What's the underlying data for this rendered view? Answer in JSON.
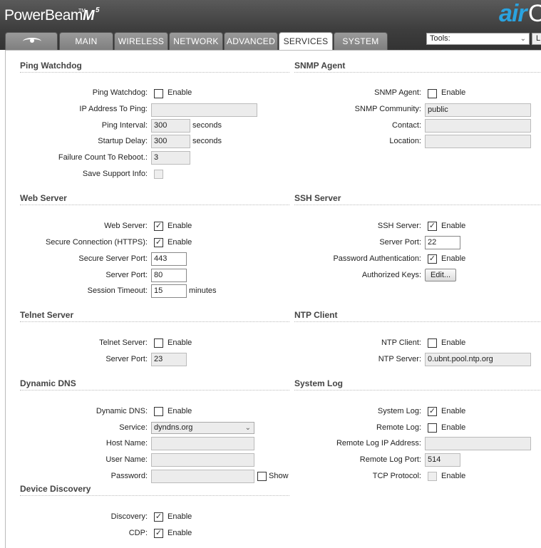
{
  "header": {
    "brand": "PowerBeam",
    "brand_tm": "TM",
    "brand_model": "M",
    "brand_model_sub": "5",
    "airos_air": "air",
    "airos_o": "O"
  },
  "tabs": [
    {
      "label": "",
      "icon": "ubiquiti-logo-icon"
    },
    {
      "label": "MAIN"
    },
    {
      "label": "WIRELESS"
    },
    {
      "label": "NETWORK"
    },
    {
      "label": "ADVANCED"
    },
    {
      "label": "SERVICES",
      "active": true
    },
    {
      "label": "SYSTEM"
    }
  ],
  "tools": {
    "selected": "Tools:",
    "button_label": "L"
  },
  "check_mark": "✓",
  "ping_watchdog": {
    "title": "Ping Watchdog",
    "enable_label": "Ping Watchdog:",
    "enable_text": "Enable",
    "enabled": false,
    "ip_label": "IP Address To Ping:",
    "ip_value": "",
    "interval_label": "Ping Interval:",
    "interval_value": "300",
    "interval_unit": "seconds",
    "startup_label": "Startup Delay:",
    "startup_value": "300",
    "startup_unit": "seconds",
    "failure_label": "Failure Count To Reboot.:",
    "failure_value": "3",
    "support_label": "Save Support Info:"
  },
  "snmp": {
    "title": "SNMP Agent",
    "agent_label": "SNMP Agent:",
    "enable_text": "Enable",
    "enabled": false,
    "community_label": "SNMP Community:",
    "community_value": "public",
    "contact_label": "Contact:",
    "contact_value": "",
    "location_label": "Location:",
    "location_value": ""
  },
  "web_server": {
    "title": "Web Server",
    "server_label": "Web Server:",
    "enable_text": "Enable",
    "enabled": true,
    "https_label": "Secure Connection (HTTPS):",
    "https_enabled": true,
    "secure_port_label": "Secure Server Port:",
    "secure_port_value": "443",
    "port_label": "Server Port:",
    "port_value": "80",
    "timeout_label": "Session Timeout:",
    "timeout_value": "15",
    "timeout_unit": "minutes"
  },
  "ssh": {
    "title": "SSH Server",
    "server_label": "SSH Server:",
    "enable_text": "Enable",
    "enabled": true,
    "port_label": "Server Port:",
    "port_value": "22",
    "password_label": "Password Authentication:",
    "password_enabled": true,
    "keys_label": "Authorized Keys:",
    "keys_button": "Edit..."
  },
  "telnet": {
    "title": "Telnet Server",
    "server_label": "Telnet Server:",
    "enable_text": "Enable",
    "enabled": false,
    "port_label": "Server Port:",
    "port_value": "23"
  },
  "ntp": {
    "title": "NTP Client",
    "client_label": "NTP Client:",
    "enable_text": "Enable",
    "enabled": false,
    "server_label": "NTP Server:",
    "server_value": "0.ubnt.pool.ntp.org"
  },
  "ddns": {
    "title": "Dynamic DNS",
    "ddns_label": "Dynamic DNS:",
    "enable_text": "Enable",
    "enabled": false,
    "service_label": "Service:",
    "service_value": "dyndns.org",
    "host_label": "Host Name:",
    "host_value": "",
    "user_label": "User Name:",
    "user_value": "",
    "password_label": "Password:",
    "password_value": "",
    "show_text": "Show"
  },
  "syslog": {
    "title": "System Log",
    "log_label": "System Log:",
    "enable_text": "Enable",
    "enabled": true,
    "remote_label": "Remote Log:",
    "remote_enabled": false,
    "remote_ip_label": "Remote Log IP Address:",
    "remote_ip_value": "",
    "remote_port_label": "Remote Log Port:",
    "remote_port_value": "514",
    "tcp_label": "TCP Protocol:"
  },
  "discovery": {
    "title": "Device Discovery",
    "discovery_label": "Discovery:",
    "enable_text": "Enable",
    "enabled": true,
    "cdp_label": "CDP:",
    "cdp_enabled": true
  }
}
